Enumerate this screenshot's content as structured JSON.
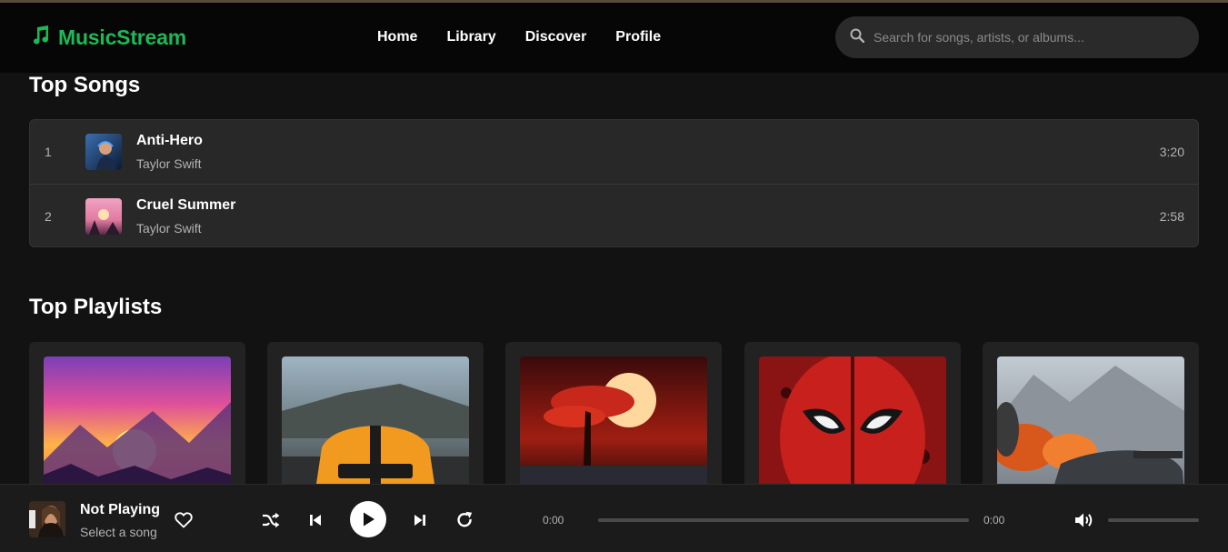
{
  "app": {
    "name": "MusicStream",
    "accent": "#1db954"
  },
  "nav": {
    "items": [
      "Home",
      "Library",
      "Discover",
      "Profile"
    ]
  },
  "search": {
    "placeholder": "Search for songs, artists, or albums...",
    "value": ""
  },
  "top_songs": {
    "title": "Top Songs",
    "items": [
      {
        "index": "1",
        "title": "Anti-Hero",
        "artist": "Taylor Swift",
        "duration": "3:20"
      },
      {
        "index": "2",
        "title": "Cruel Summer",
        "artist": "Taylor Swift",
        "duration": "2:58"
      }
    ]
  },
  "top_playlists": {
    "title": "Top Playlists",
    "count": 5
  },
  "player": {
    "title": "Not Playing",
    "subtitle": "Select a song",
    "current_time": "0:00",
    "total_time": "0:00",
    "progress": 0,
    "volume": 0
  }
}
